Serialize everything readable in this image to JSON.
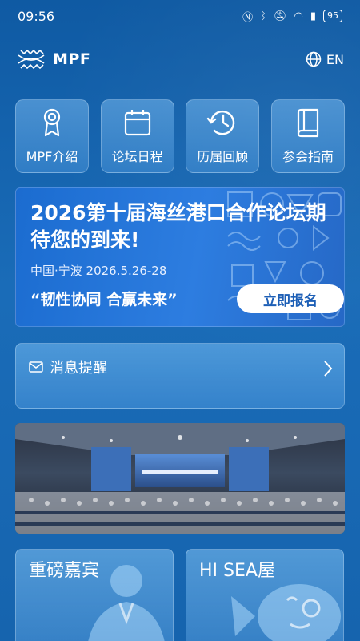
{
  "status_bar": {
    "time": "09:56",
    "battery": "95"
  },
  "header": {
    "logo_text": "MPF",
    "language": "EN"
  },
  "quick_nav": [
    {
      "label": "MPF介绍",
      "icon": "award-icon"
    },
    {
      "label": "论坛日程",
      "icon": "calendar-icon"
    },
    {
      "label": "历届回顾",
      "icon": "history-icon"
    },
    {
      "label": "参会指南",
      "icon": "book-icon"
    }
  ],
  "banner": {
    "title": "2026第十届海丝港口合作论坛期待您的到来!",
    "location": "中国·宁波 2026.5.26-28",
    "slogan": "“韧性协同 合赢未来”",
    "register_label": "立即报名"
  },
  "messages": {
    "title": "消息提醒"
  },
  "cards": {
    "guests": "重磅嘉宾",
    "hisea": "HI SEA屋"
  },
  "colors": {
    "background": "#1560a8",
    "accent": "#1d5fb6",
    "button": "#ffffff"
  }
}
